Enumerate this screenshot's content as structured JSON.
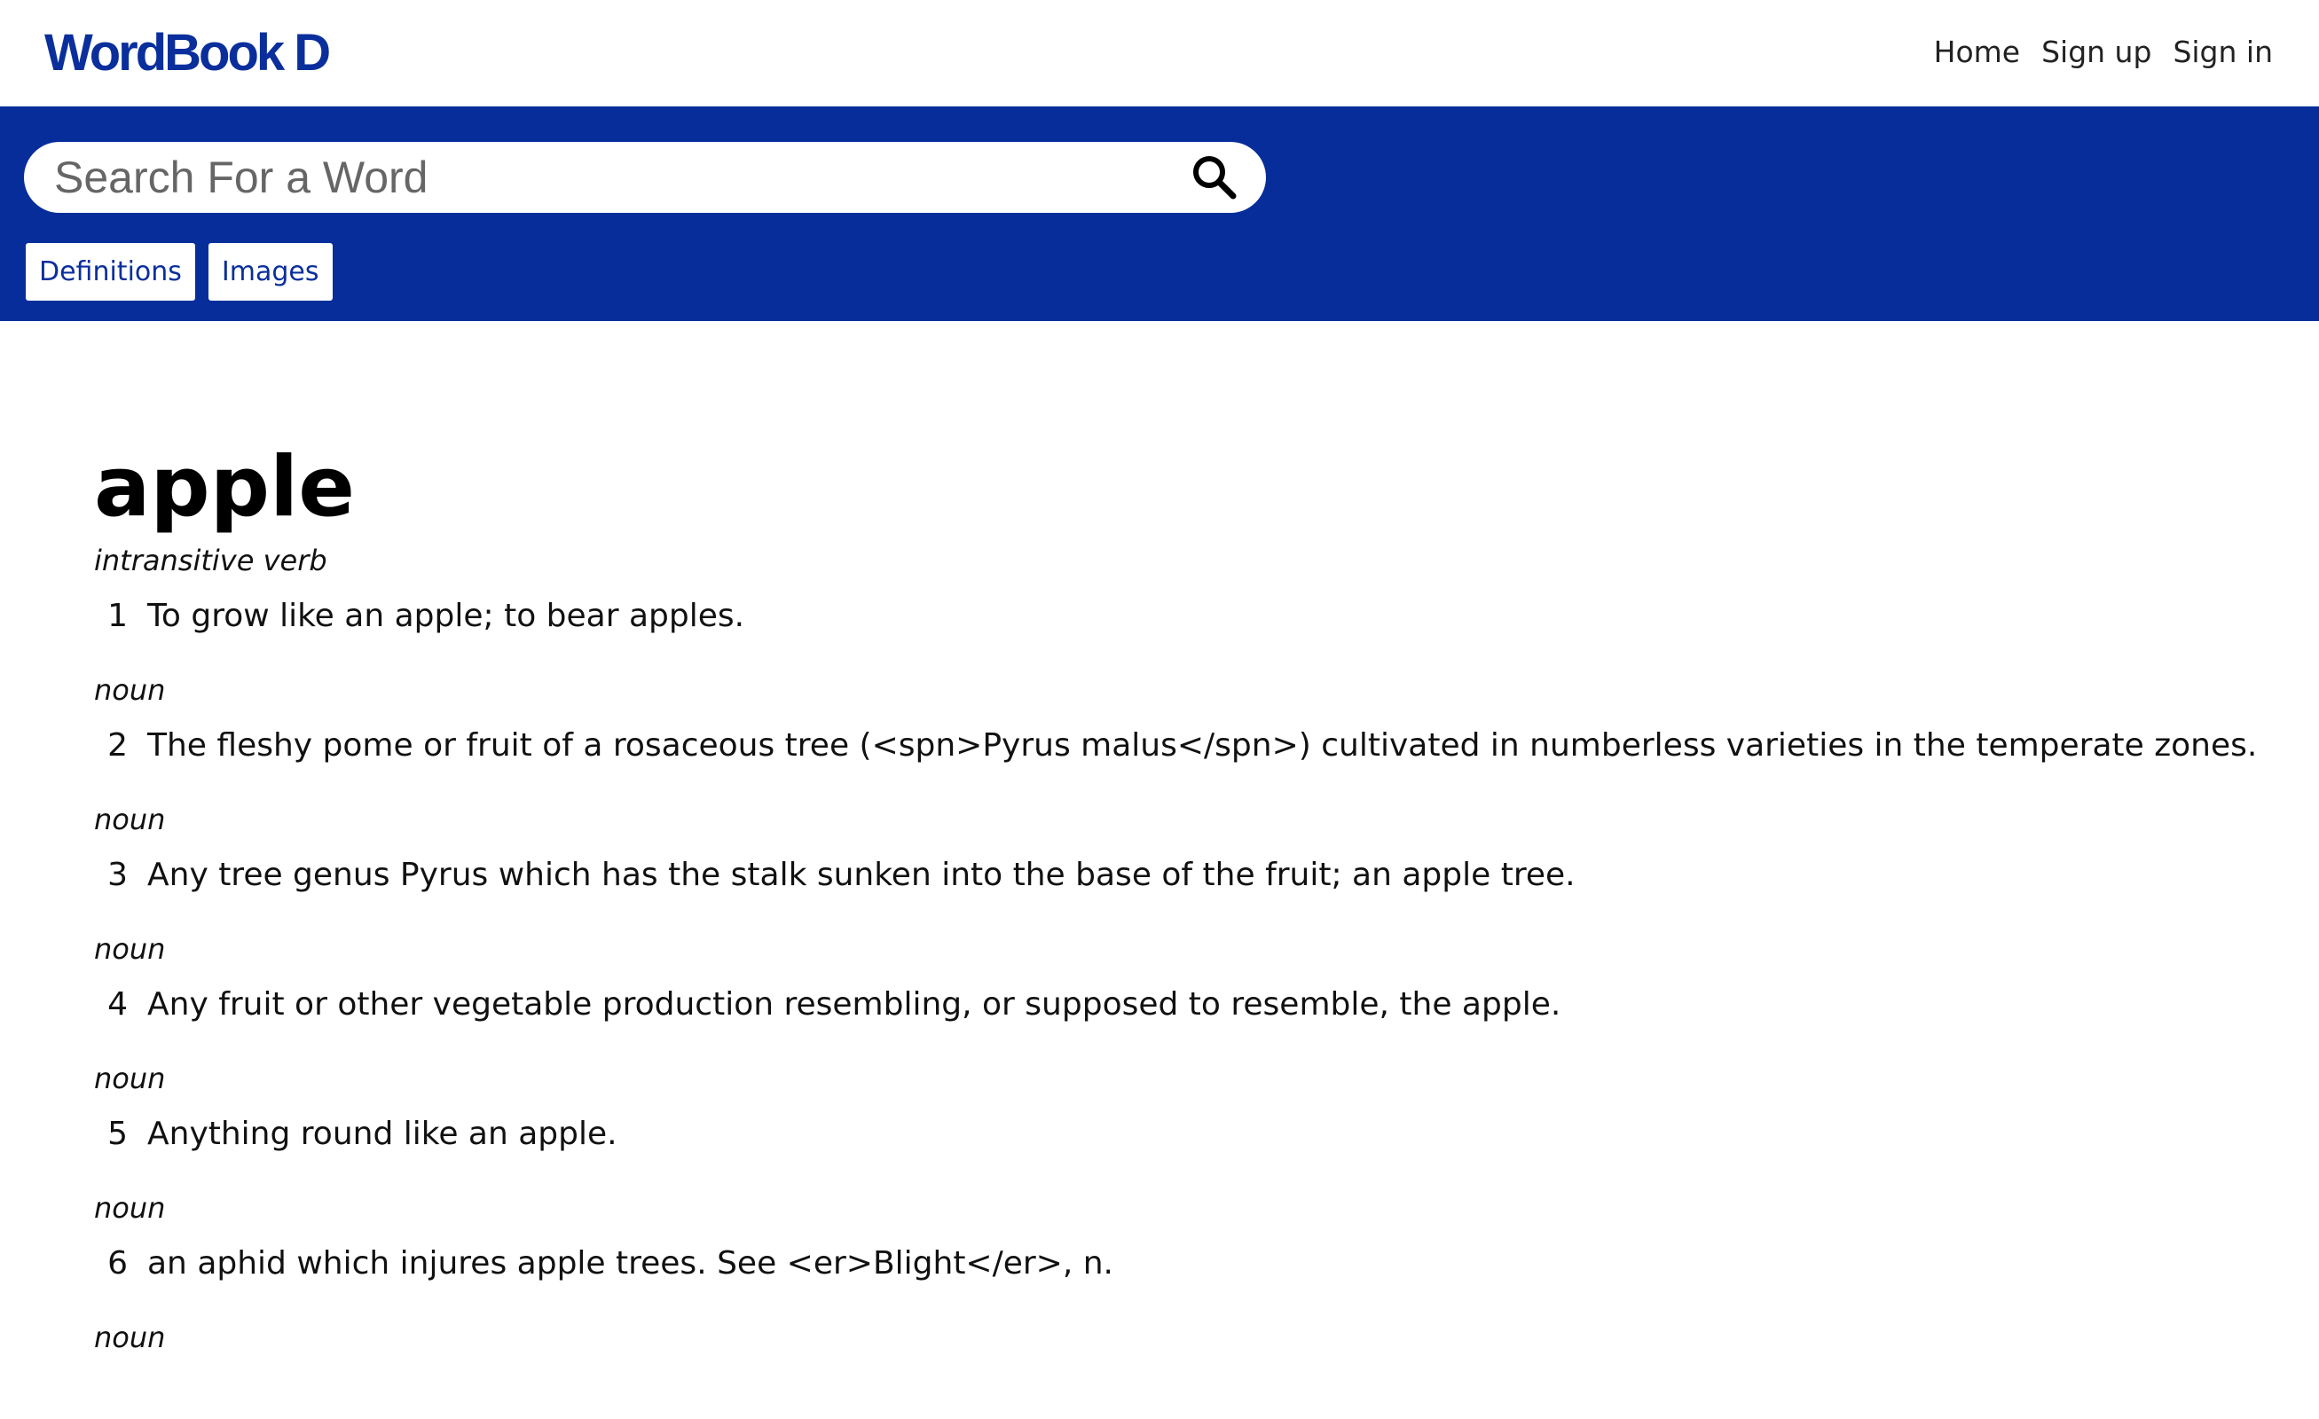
{
  "header": {
    "logo": "WordBook D",
    "nav": [
      {
        "label": "Home"
      },
      {
        "label": "Sign up"
      },
      {
        "label": "Sign in"
      }
    ]
  },
  "search": {
    "placeholder": "Search For a Word",
    "value": "",
    "button_icon": "search-icon"
  },
  "tabs": [
    {
      "label": "Definitions"
    },
    {
      "label": "Images"
    }
  ],
  "entry": {
    "word": "apple",
    "definitions": [
      {
        "pos": "intransitive verb",
        "num": "1",
        "text": "To grow like an apple; to bear apples."
      },
      {
        "pos": "noun",
        "num": "2",
        "text": "The fleshy pome or fruit of a rosaceous tree (<spn>Pyrus malus</spn>) cultivated in numberless varieties in the temperate zones."
      },
      {
        "pos": "noun",
        "num": "3",
        "text": "Any tree genus Pyrus which has the stalk sunken into the base of the fruit; an apple tree."
      },
      {
        "pos": "noun",
        "num": "4",
        "text": "Any fruit or other vegetable production resembling, or supposed to resemble, the apple."
      },
      {
        "pos": "noun",
        "num": "5",
        "text": "Anything round like an apple."
      },
      {
        "pos": "noun",
        "num": "6",
        "text": "an aphid which injures apple trees. See <er>Blight</er>, n."
      },
      {
        "pos": "noun"
      }
    ]
  },
  "colors": {
    "brand": "#0a2f9c",
    "band": "#072d9b",
    "background": "#ffffff"
  }
}
